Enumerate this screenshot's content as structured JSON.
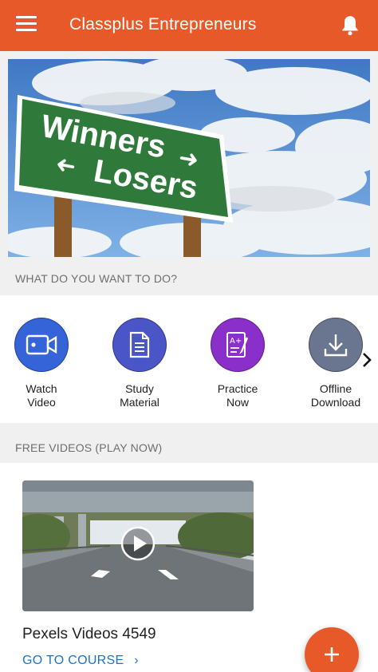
{
  "appbar": {
    "title": "Classplus Entrepreneurs"
  },
  "banner": {
    "sign_line1": "Winners",
    "sign_line2": "Losers"
  },
  "sections": {
    "actions_heading": "WHAT DO YOU WANT TO DO?",
    "videos_heading": "FREE VIDEOS (PLAY NOW)"
  },
  "actions": [
    {
      "label": "Watch\nVideo",
      "color": "#3563d8",
      "icon": "video-camera-icon"
    },
    {
      "label": "Study\nMaterial",
      "color": "#4a55c8",
      "icon": "document-icon"
    },
    {
      "label": "Practice\nNow",
      "color": "#8a2fc9",
      "icon": "test-paper-icon"
    },
    {
      "label": "Offline\nDownload",
      "color": "#6a7590",
      "icon": "download-icon"
    }
  ],
  "video": {
    "title": "Pexels Videos 4549",
    "cta": "GO TO COURSE"
  },
  "colors": {
    "brand": "#e8592a",
    "link": "#1a73c9"
  }
}
